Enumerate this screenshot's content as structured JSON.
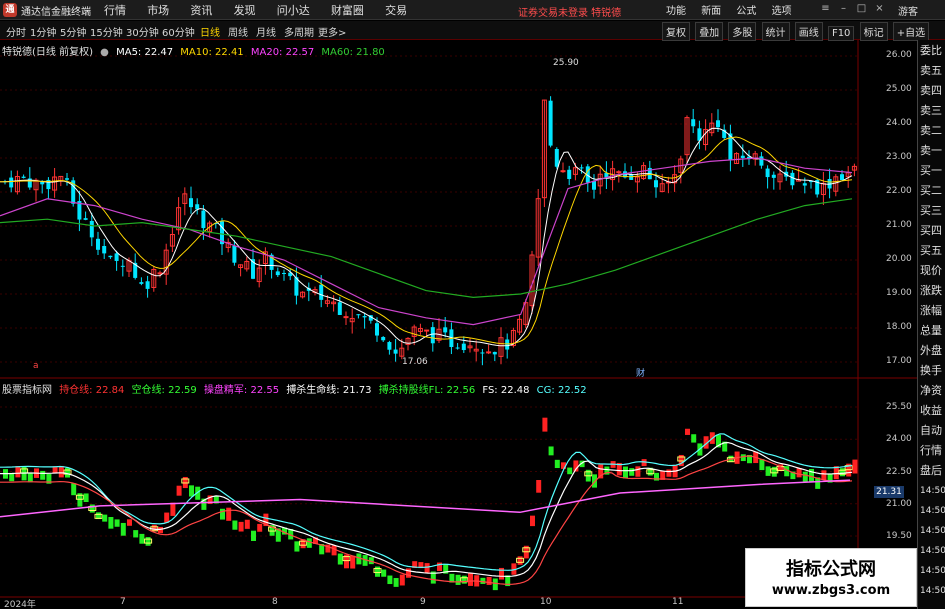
{
  "titlebar": {
    "logo_text": "通",
    "app_name": "通达信金融终端",
    "menu": [
      "行情",
      "市场",
      "资讯",
      "发现",
      "问小达",
      "财富圈",
      "交易"
    ],
    "login_status": "证券交易未登录  特锐德",
    "right_menu": [
      "功能",
      "新面",
      "公式",
      "选项"
    ],
    "guest": "游客"
  },
  "periods": [
    {
      "label": "分时",
      "active": false
    },
    {
      "label": "1分钟",
      "active": false
    },
    {
      "label": "5分钟",
      "active": false
    },
    {
      "label": "15分钟",
      "active": false
    },
    {
      "label": "30分钟",
      "active": false
    },
    {
      "label": "60分钟",
      "active": false
    },
    {
      "label": "日线",
      "active": true
    },
    {
      "label": "周线",
      "active": false
    },
    {
      "label": "月线",
      "active": false
    },
    {
      "label": "多周期",
      "active": false
    },
    {
      "label": "更多>",
      "active": false
    }
  ],
  "tools": [
    "复权",
    "叠加",
    "多股",
    "统计",
    "画线",
    "F10",
    "标记",
    "+自选"
  ],
  "main_legend": {
    "title": "特锐德(日线 前复权)",
    "items": [
      {
        "label": "MA5: 22.47",
        "color": "#ffffff"
      },
      {
        "label": "MA10: 22.41",
        "color": "#ffd700"
      },
      {
        "label": "MA20: 22.57",
        "color": "#ff44ff"
      },
      {
        "label": "MA60: 21.80",
        "color": "#33cc33"
      }
    ]
  },
  "sub_legend": {
    "title": "股票指标网",
    "items": [
      {
        "label": "持仓线: 22.84",
        "color": "#ff3333"
      },
      {
        "label": "空仓线: 22.59",
        "color": "#33ff33"
      },
      {
        "label": "操盘精军: 22.55",
        "color": "#ff44ff"
      },
      {
        "label": "搏杀生命线: 21.73",
        "color": "#ffffff"
      },
      {
        "label": "搏杀持股线FL: 22.56",
        "color": "#33ff33"
      },
      {
        "label": "FS: 22.48",
        "color": "#ffffff"
      },
      {
        "label": "CG: 22.52",
        "color": "#55ffff"
      }
    ]
  },
  "right_panel": [
    "委比",
    "卖五",
    "卖四",
    "卖三",
    "卖二",
    "卖一",
    "买一",
    "买二",
    "买三",
    "买四",
    "买五",
    "现价",
    "涨跌",
    "涨幅",
    "总量",
    "外盘",
    "换手",
    "净资",
    "收益",
    "自动",
    "行情",
    "盘后",
    "14:50",
    "14:50",
    "14:50",
    "14:50",
    "14:50",
    "14:50"
  ],
  "main_axis": [
    "26.00",
    "25.00",
    "24.00",
    "23.00",
    "22.00",
    "21.00",
    "20.00",
    "19.00",
    "18.00",
    "17.00"
  ],
  "sub_axis": [
    "25.50",
    "24.00",
    "22.50",
    "21.00",
    "19.50"
  ],
  "current_price": "21.31",
  "high_label": "25.90",
  "low_label": "17.06",
  "x_labels": [
    "2024年",
    "7",
    "8",
    "9",
    "10",
    "11"
  ],
  "marks": [
    "a",
    "财"
  ],
  "watermark": {
    "line1": "指标公式网",
    "line2": "www.zbgs3.com"
  },
  "chart_data": {
    "type": "line",
    "title": "特锐德(日线 前复权)",
    "ylim": [
      17.0,
      26.0
    ],
    "series": [
      {
        "name": "MA60",
        "values": [
          21.1,
          21.2,
          21.0,
          21.1,
          20.9,
          20.7,
          20.4,
          20.1,
          19.6,
          19.1,
          18.9,
          19.0,
          19.3,
          19.7,
          20.2,
          20.7,
          21.2,
          21.6,
          21.8
        ]
      },
      {
        "name": "MA20",
        "values": [
          21.3,
          21.8,
          21.6,
          21.2,
          20.9,
          20.4,
          20.0,
          19.3,
          18.6,
          18.3,
          18.1,
          18.4,
          22.1,
          22.5,
          22.7,
          22.9,
          23.0,
          22.7,
          22.57
        ]
      }
    ]
  }
}
